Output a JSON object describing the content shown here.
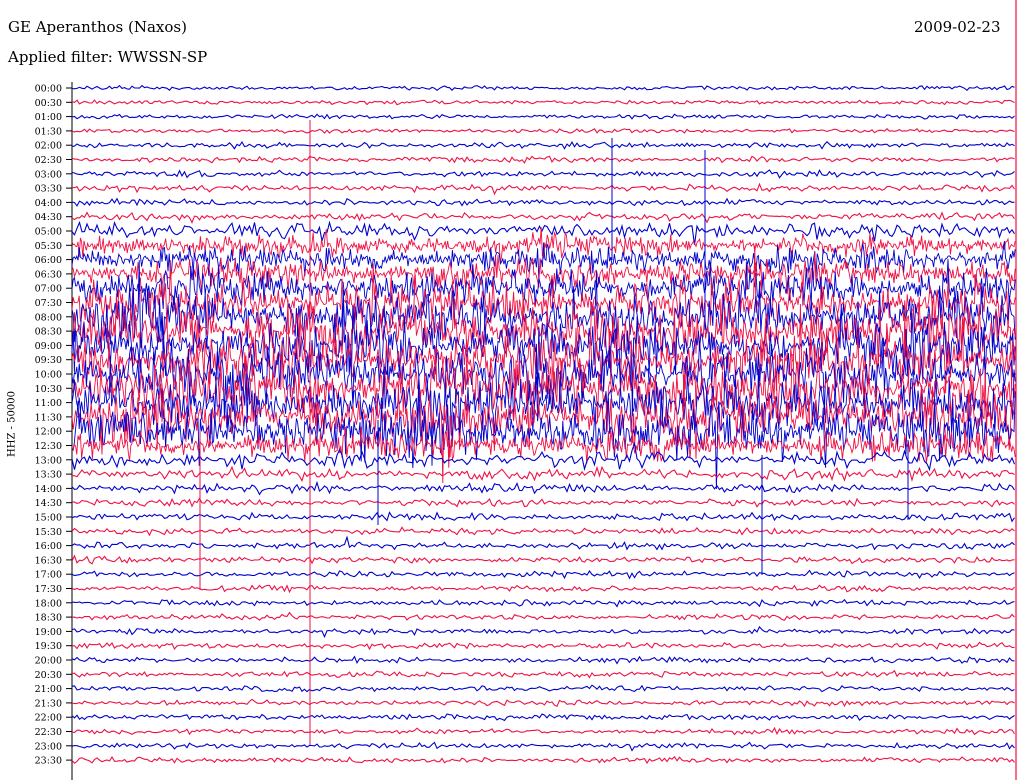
{
  "header": {
    "station": "GE Aperanthos (Naxos)",
    "date": "2009-02-23",
    "filter": "Applied filter: WWSSN-SP"
  },
  "chart_data": {
    "type": "line",
    "title": "GE Aperanthos (Naxos)",
    "subtitle": "Applied filter: WWSSN-SP",
    "date": "2009-02-23",
    "ylabel": "HHZ - 50000",
    "xlabel": "",
    "grid": false,
    "legend": "none",
    "trace_colors": [
      "#0000cc",
      "#ee1144"
    ],
    "time_labels": [
      "00:00",
      "00:30",
      "01:00",
      "01:30",
      "02:00",
      "02:30",
      "03:00",
      "03:30",
      "04:00",
      "04:30",
      "05:00",
      "05:30",
      "06:00",
      "06:30",
      "07:00",
      "07:30",
      "08:00",
      "08:30",
      "09:00",
      "09:30",
      "10:00",
      "10:30",
      "11:00",
      "11:30",
      "12:00",
      "12:30",
      "13:00",
      "13:30",
      "14:00",
      "14:30",
      "15:00",
      "15:30",
      "16:00",
      "16:30",
      "17:00",
      "17:30",
      "18:00",
      "18:30",
      "19:00",
      "19:30",
      "20:00",
      "20:30",
      "21:00",
      "21:30",
      "22:00",
      "22:30",
      "23:00",
      "23:30"
    ],
    "activity_level": [
      0.05,
      0.05,
      0.05,
      0.05,
      0.08,
      0.08,
      0.1,
      0.1,
      0.1,
      0.12,
      0.3,
      0.4,
      0.5,
      0.55,
      0.7,
      0.85,
      0.95,
      1.0,
      1.0,
      1.0,
      1.0,
      1.0,
      1.0,
      1.0,
      0.95,
      0.55,
      0.3,
      0.2,
      0.15,
      0.12,
      0.12,
      0.1,
      0.1,
      0.1,
      0.1,
      0.08,
      0.08,
      0.08,
      0.08,
      0.08,
      0.08,
      0.08,
      0.08,
      0.08,
      0.08,
      0.08,
      0.08,
      0.08
    ]
  }
}
